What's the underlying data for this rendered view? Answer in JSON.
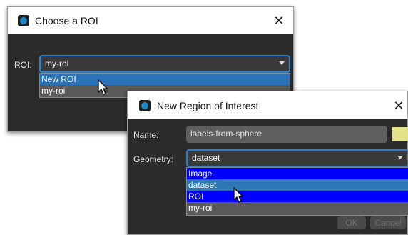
{
  "roi_dialog": {
    "title": "Choose a ROI",
    "roi_label": "ROI:",
    "roi_selected": "my-roi",
    "roi_options": [
      {
        "label": "New ROI",
        "highlighted": true
      },
      {
        "label": "my-roi",
        "highlighted": false
      }
    ],
    "icon": "app-icon",
    "close_icon": "close-icon"
  },
  "new_roi_dialog": {
    "title": "New Region of Interest",
    "name_label": "Name:",
    "name_value": "labels-from-sphere",
    "color_swatch": "#e3e18a",
    "geometry_label": "Geometry:",
    "geometry_selected": "dataset",
    "geometry_options": [
      {
        "label": "Image",
        "style": "selected"
      },
      {
        "label": "dataset",
        "style": "hover"
      },
      {
        "label": "ROI",
        "style": "selected"
      },
      {
        "label": "my-roi",
        "style": "normal"
      }
    ],
    "ok_label": "OK",
    "cancel_label": "Cancel",
    "icon": "app-icon",
    "close_icon": "close-icon"
  },
  "colors": {
    "dialog_bg": "#2b2b2b",
    "accent_border": "#2a7fcf",
    "highlight": "#2b73b8",
    "selected_blue": "#0000ff",
    "hover_blue": "#2e77b6"
  }
}
